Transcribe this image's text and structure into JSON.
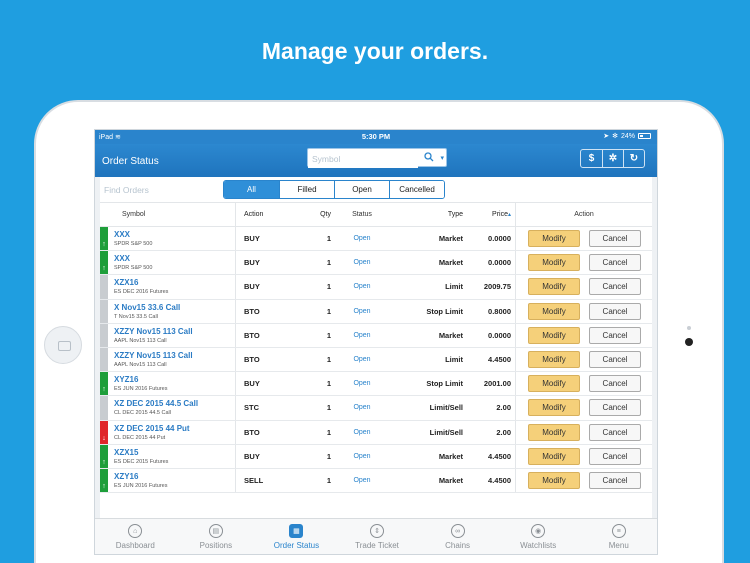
{
  "headline": "Manage your orders.",
  "status_bar": {
    "carrier": "iPad",
    "time": "5:30 PM",
    "battery": "24%"
  },
  "nav": {
    "title": "Order Status",
    "search_placeholder": "Symbol",
    "buttons": [
      {
        "icon": "dollar-icon",
        "glyph": "$"
      },
      {
        "icon": "settings-icon",
        "glyph": "✲"
      },
      {
        "icon": "refresh-icon",
        "glyph": "↻"
      }
    ]
  },
  "filter": {
    "find_placeholder": "Find Orders",
    "segments": [
      "All",
      "Filled",
      "Open",
      "Cancelled"
    ],
    "selected": "All"
  },
  "columns": {
    "symbol": "Symbol",
    "action": "Action",
    "qty": "Qty",
    "status": "Status",
    "type": "Type",
    "price": "Price",
    "actions": "Action"
  },
  "orders": [
    {
      "symbol": "XXX",
      "desc": "SPDR S&P 500",
      "action": "BUY",
      "qty": "1",
      "status": "Open",
      "type": "Market",
      "price": "0.0000",
      "indicator": "up"
    },
    {
      "symbol": "XXX",
      "desc": "SPDR S&P 500",
      "action": "BUY",
      "qty": "1",
      "status": "Open",
      "type": "Market",
      "price": "0.0000",
      "indicator": "up"
    },
    {
      "symbol": "XZX16",
      "desc": "ES DEC 2016 Futures",
      "action": "BUY",
      "qty": "1",
      "status": "Open",
      "type": "Limit",
      "price": "2009.75",
      "indicator": "none"
    },
    {
      "symbol": "X Nov15 33.6 Call",
      "desc": "T Nov15 33.5 Call",
      "action": "BTO",
      "qty": "1",
      "status": "Open",
      "type": "Stop Limit",
      "price": "0.8000",
      "indicator": "none"
    },
    {
      "symbol": "XZZY Nov15 113 Call",
      "desc": "AAPL Nov15 113 Call",
      "action": "BTO",
      "qty": "1",
      "status": "Open",
      "type": "Market",
      "price": "0.0000",
      "indicator": "none"
    },
    {
      "symbol": "XZZY Nov15 113 Call",
      "desc": "AAPL Nov15 113 Call",
      "action": "BTO",
      "qty": "1",
      "status": "Open",
      "type": "Limit",
      "price": "4.4500",
      "indicator": "none"
    },
    {
      "symbol": "XYZ16",
      "desc": "ES JUN 2016 Futures",
      "action": "BUY",
      "qty": "1",
      "status": "Open",
      "type": "Stop Limit",
      "price": "2001.00",
      "indicator": "up"
    },
    {
      "symbol": "XZ DEC 2015 44.5 Call",
      "desc": "CL DEC 2015 44.5 Call",
      "action": "STC",
      "qty": "1",
      "status": "Open",
      "type": "Limit/Sell",
      "price": "2.00",
      "indicator": "none"
    },
    {
      "symbol": "XZ DEC 2015 44 Put",
      "desc": "CL DEC 2015 44 Put",
      "action": "BTO",
      "qty": "1",
      "status": "Open",
      "type": "Limit/Sell",
      "price": "2.00",
      "indicator": "down"
    },
    {
      "symbol": "XZX15",
      "desc": "ES DEC 2015 Futures",
      "action": "BUY",
      "qty": "1",
      "status": "Open",
      "type": "Market",
      "price": "4.4500",
      "indicator": "up"
    },
    {
      "symbol": "XZY16",
      "desc": "ES JUN 2016 Futures",
      "action": "SELL",
      "qty": "1",
      "status": "Open",
      "type": "Market",
      "price": "4.4500",
      "indicator": "up"
    }
  ],
  "buttons": {
    "modify": "Modify",
    "cancel": "Cancel"
  },
  "tabs": [
    {
      "label": "Dashboard",
      "icon": "home-icon",
      "glyph": "⌂"
    },
    {
      "label": "Positions",
      "icon": "positions-icon",
      "glyph": "▤"
    },
    {
      "label": "Order Status",
      "icon": "order-status-icon",
      "glyph": "▦",
      "active": true
    },
    {
      "label": "Trade Ticket",
      "icon": "trade-ticket-icon",
      "glyph": "⇕"
    },
    {
      "label": "Chains",
      "icon": "chains-icon",
      "glyph": "∞"
    },
    {
      "label": "Watchlists",
      "icon": "watchlists-icon",
      "glyph": "◉"
    },
    {
      "label": "Menu",
      "icon": "menu-icon",
      "glyph": "≡"
    }
  ],
  "colors": {
    "up": "#1e9e3a",
    "down": "#e0262a",
    "none": "#c8ccd0",
    "accent": "#2a84cc",
    "modify": "#f5d07a"
  }
}
